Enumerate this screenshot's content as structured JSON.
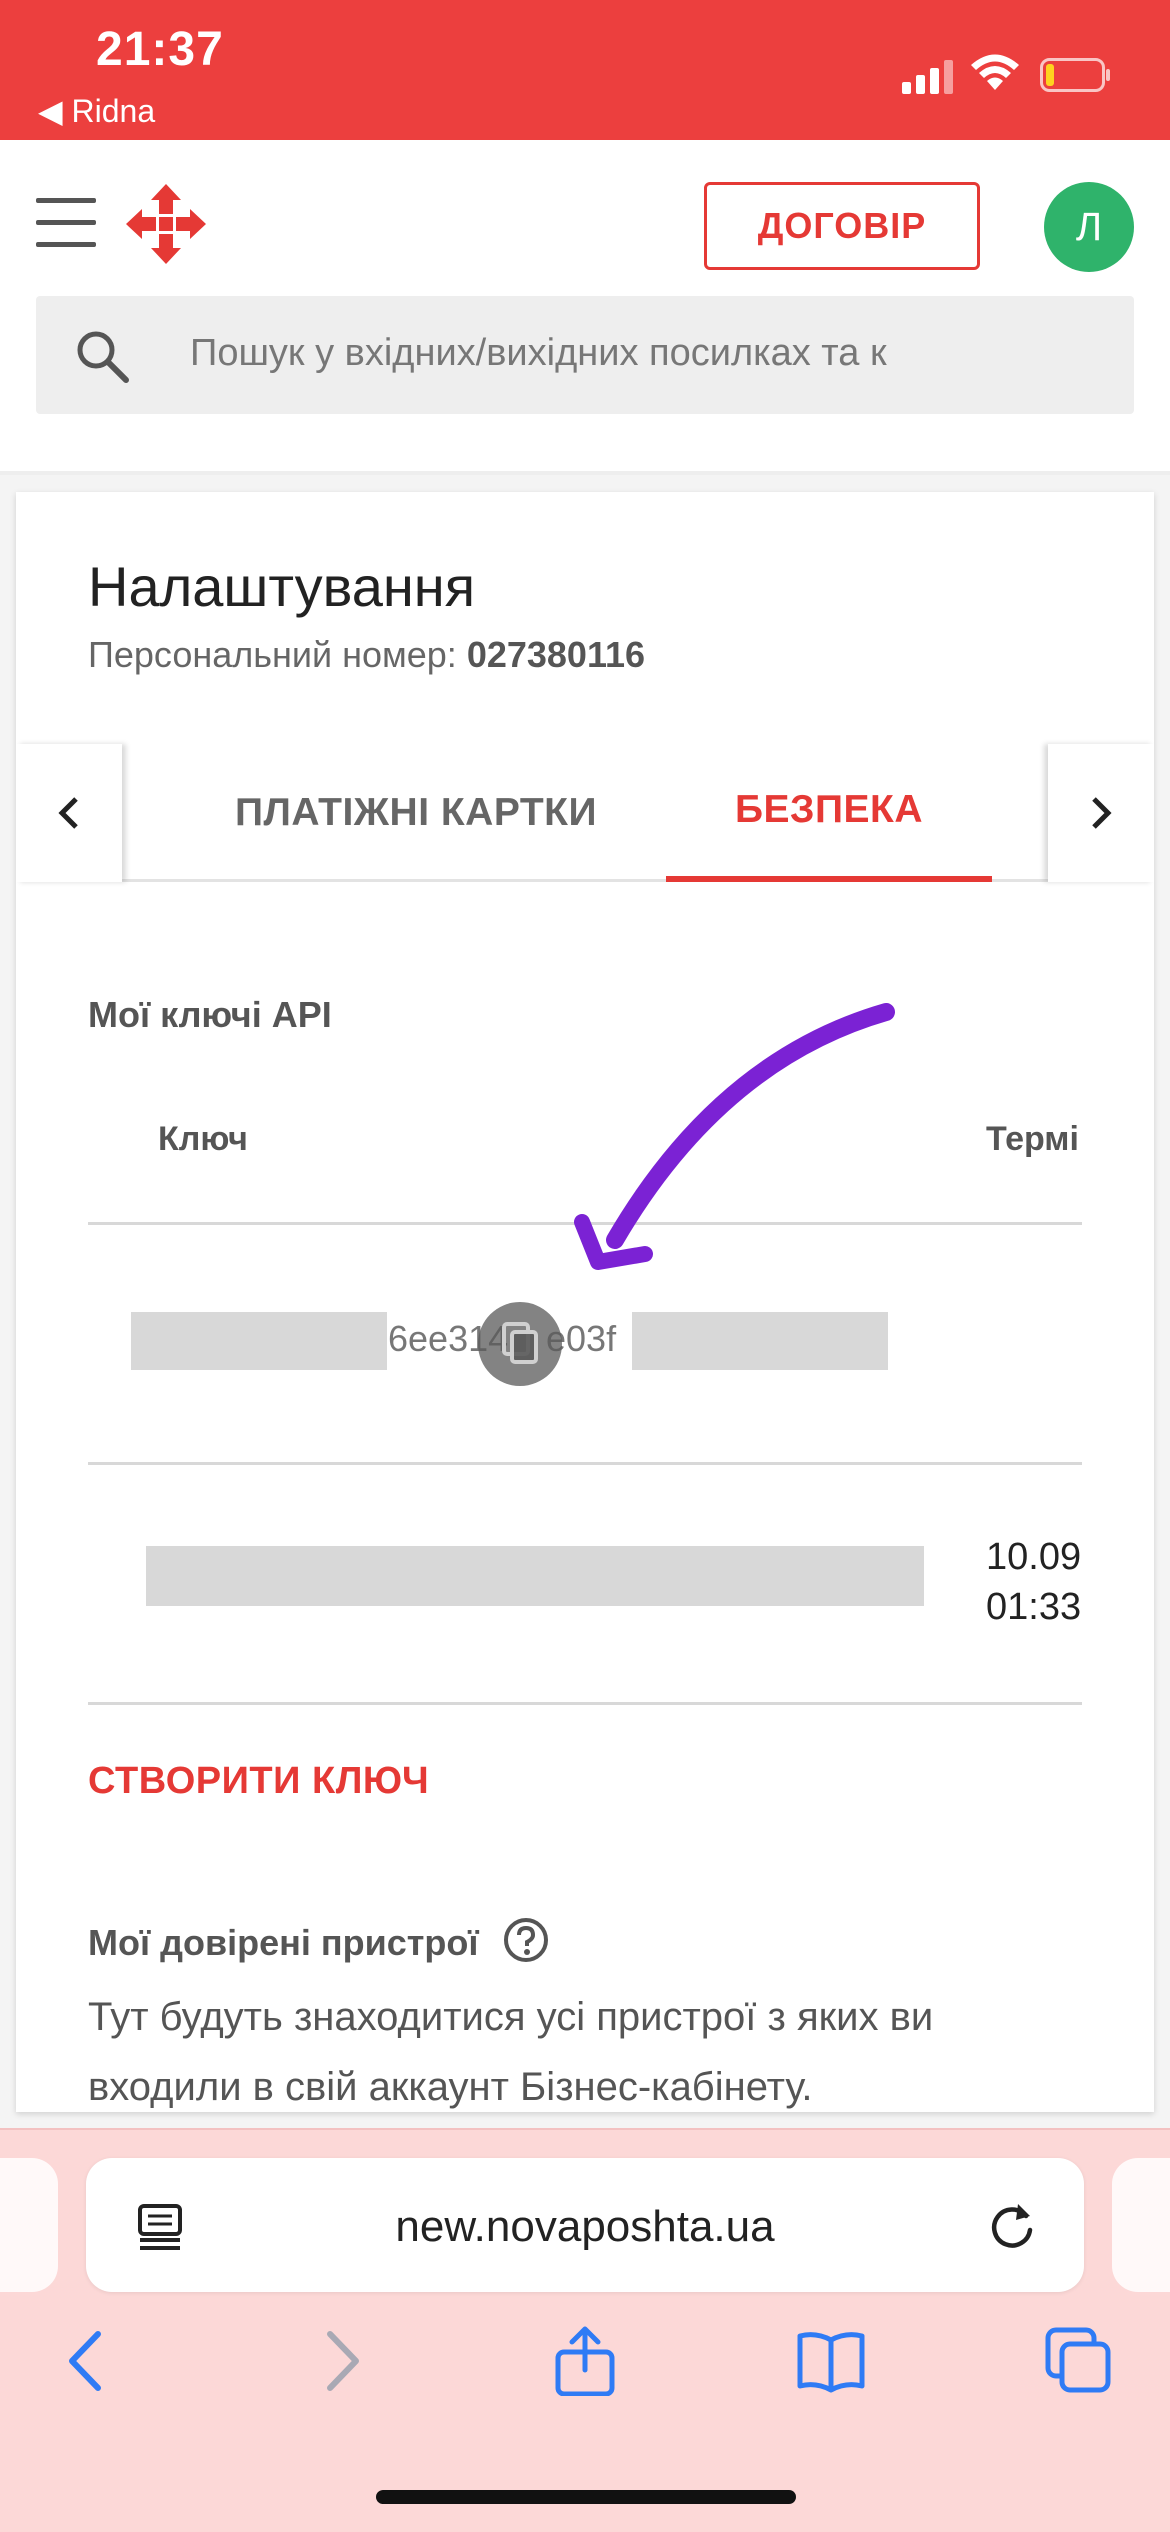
{
  "status": {
    "time": "21:37",
    "back_app": "◀ Ridna"
  },
  "header": {
    "contract_label": "ДОГОВІР",
    "avatar_letter": "Л",
    "search_placeholder": "Пошук у вхідних/вихідних посилках та к"
  },
  "settings": {
    "title": "Налаштування",
    "personal_number_label": "Персональний номер:",
    "personal_number_value": "027380116",
    "tabs": [
      {
        "label": "ПЛАТІЖНІ КАРТКИ",
        "active": false
      },
      {
        "label": "БЕЗПЕКА",
        "active": true
      }
    ],
    "api_keys": {
      "section_label": "Мої ключі API",
      "col_key": "Ключ",
      "col_term": "Термі",
      "rows": [
        {
          "key_fragment_left": "6ee314",
          "key_fragment_right": "e03f",
          "term": ""
        },
        {
          "key_fragment_left": "",
          "key_fragment_right": "",
          "term_line1": "10.09",
          "term_line2": "01:33"
        }
      ],
      "create_label": "СТВОРИТИ КЛЮЧ"
    },
    "devices": {
      "title": "Мої довірені пристрої",
      "description": "Тут будуть знаходитися усі пристрої з яких ви входили в свій аккаунт Бізнес-кабінету."
    }
  },
  "browser": {
    "url": "new.novaposhta.ua"
  },
  "colors": {
    "brand_red": "#e53935",
    "status_red": "#ec3f3e",
    "avatar_green": "#2fb36b",
    "annotation_purple": "#7b22d4",
    "safari_blue": "#2f7bf5"
  }
}
